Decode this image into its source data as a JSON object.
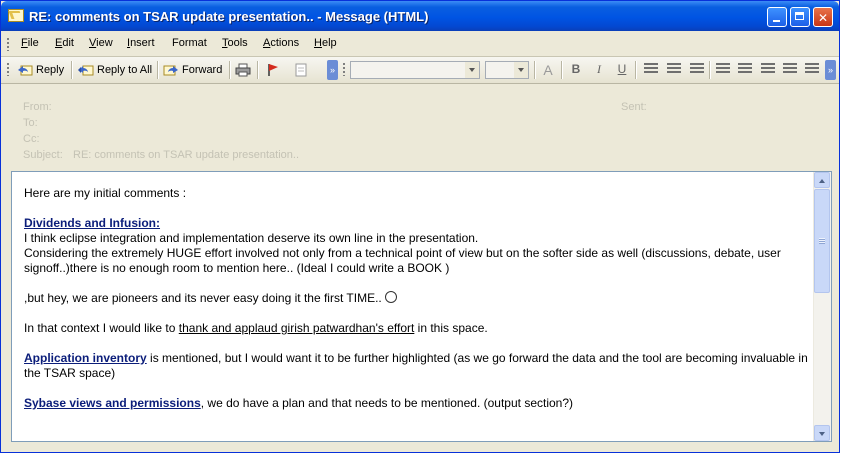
{
  "window": {
    "title": "RE: comments on TSAR update presentation.. - Message (HTML)",
    "controls": [
      "minimize",
      "maximize",
      "close"
    ]
  },
  "menu": {
    "items": [
      {
        "ul": "F",
        "rest": "ile"
      },
      {
        "ul": "E",
        "rest": "dit"
      },
      {
        "ul": "V",
        "rest": "iew"
      },
      {
        "ul": "I",
        "rest": "nsert"
      },
      {
        "ul": "",
        "rest": "Format"
      },
      {
        "ul": "T",
        "rest": "ools"
      },
      {
        "ul": "A",
        "rest": "ctions"
      },
      {
        "ul": "H",
        "rest": "elp"
      }
    ]
  },
  "toolbar": {
    "reply": "Reply",
    "reply_all": "Reply to All",
    "forward": "Forward",
    "font_combo": "",
    "size_combo": "",
    "format_buttons": [
      "A",
      "B",
      "I",
      "U"
    ]
  },
  "header": {
    "from_label": "From:",
    "to_label": "To:",
    "cc_label": "Cc:",
    "subject_label": "Subject:",
    "from_value": "",
    "to_value": "",
    "cc_value": "",
    "subject_value": "RE: comments on TSAR update presentation..",
    "sent_label": "Sent:",
    "sent_value": ""
  },
  "body": {
    "intro": "Here are my initial comments :",
    "s1_heading": "Dividends and Infusion:",
    "s1_line1": "I think eclipse integration and implementation deserve its own line in the presentation.",
    "s1_line2": "Considering the extremely HUGE effort involved not only from a technical point of view but on the softer side as well (discussions, debate, user signoff..)there is no enough room to mention here.. (Ideal I could write a BOOK )",
    "s2_line": ",but hey, we are pioneers and its never easy doing it the first TIME..",
    "s3_pre": "In that context I would like to ",
    "s3_link": "thank and applaud girish patwardhan's effort",
    "s3_post": " in this space.",
    "s4_heading": "Application inventory",
    "s4_text": " is mentioned, but I would want it to be further highlighted (as we go forward the data and the tool are becoming invaluable in the TSAR space)",
    "s5_heading": "Sybase views and permissions",
    "s5_text": ", we do have a plan and that needs to be mentioned. (output section?)"
  }
}
